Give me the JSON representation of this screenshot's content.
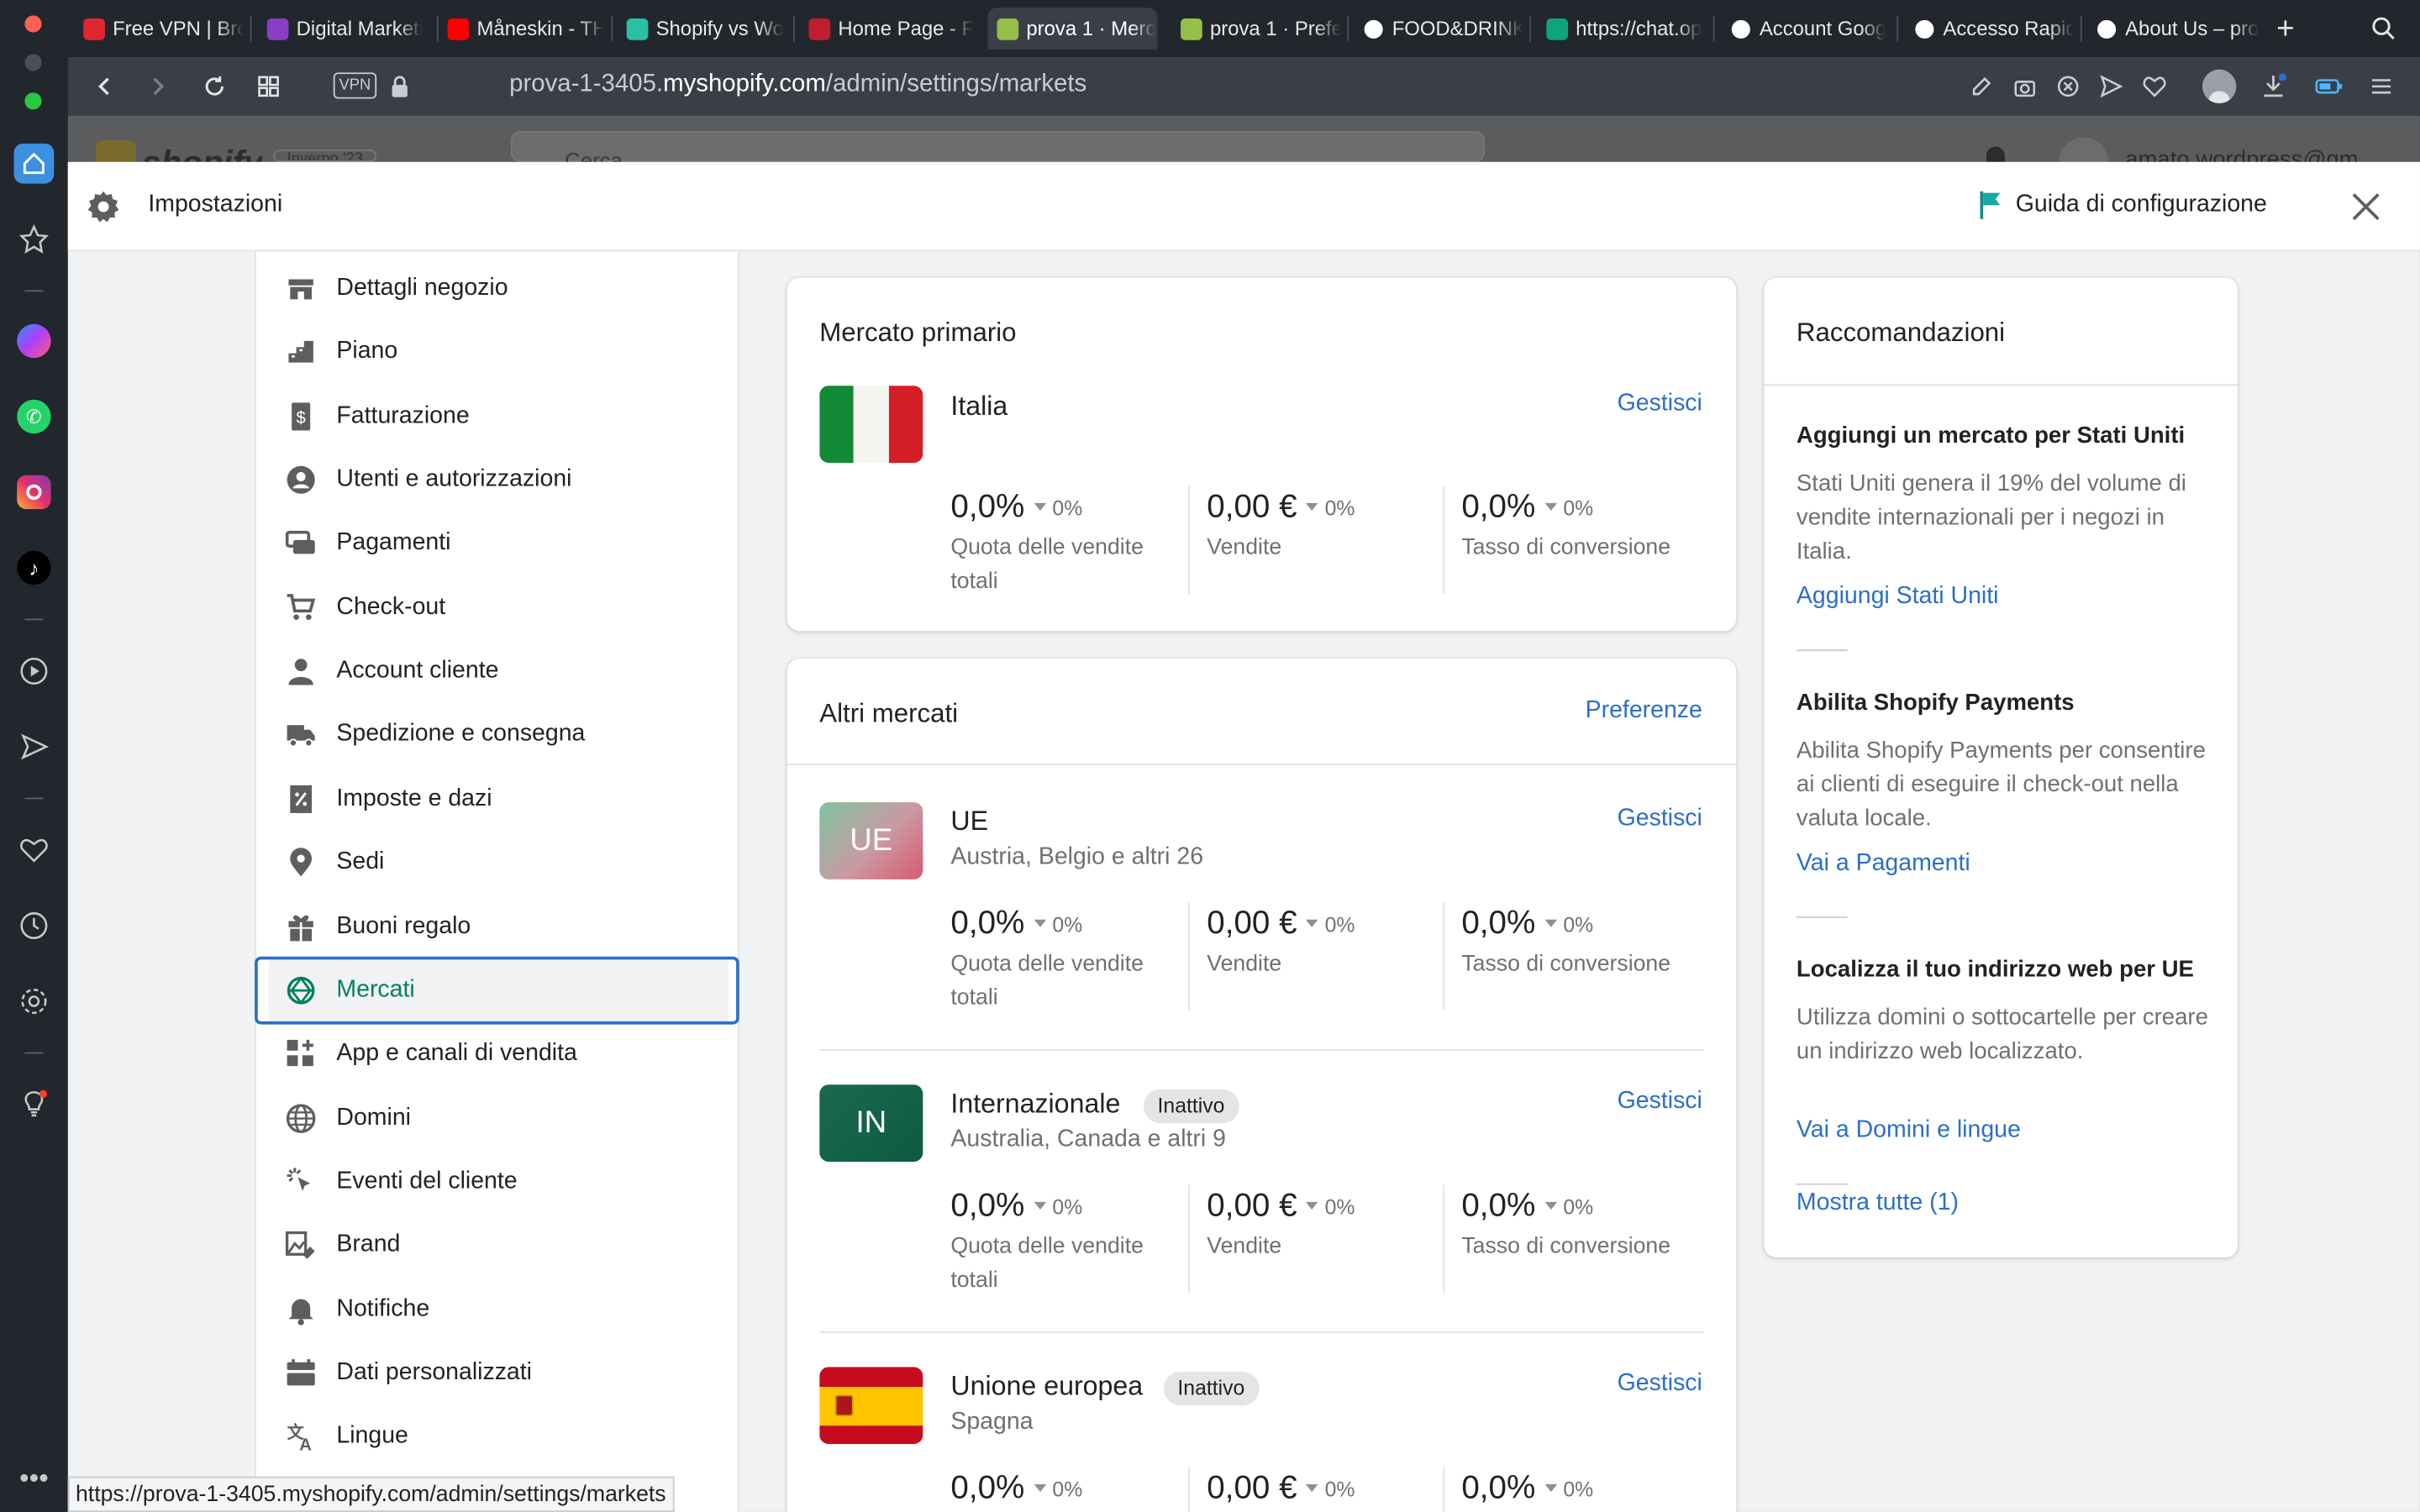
{
  "browser": {
    "tabs": [
      {
        "title": "Free VPN | Bro",
        "favicon": "opera-icon",
        "color": "#e0262f"
      },
      {
        "title": "Digital Marketi",
        "favicon": "digital-icon",
        "color": "#8b3dc6"
      },
      {
        "title": "Måneskin - TH",
        "favicon": "youtube-icon",
        "color": "#ff0000"
      },
      {
        "title": "Shopify vs Wo",
        "favicon": "bookmark-icon",
        "color": "#2bbfa4"
      },
      {
        "title": "Home Page - F",
        "favicon": "lips-icon",
        "color": "#c01e2e"
      },
      {
        "title": "prova 1 · Merc",
        "favicon": "shopify-icon",
        "color": "#95bf47"
      },
      {
        "title": "prova 1 · Prefe",
        "favicon": "shopify-icon",
        "color": "#95bf47"
      },
      {
        "title": "FOOD&DRINK",
        "favicon": "wix-icon",
        "color": "#ffffff"
      },
      {
        "title": "https://chat.op",
        "favicon": "openai-icon",
        "color": "#10a37f"
      },
      {
        "title": "Account Goog",
        "favicon": "google-icon",
        "color": "#ffffff"
      },
      {
        "title": "Accesso Rapid",
        "favicon": "grid-icon",
        "color": "#ffffff"
      },
      {
        "title": "About Us – pro",
        "favicon": "wix-icon",
        "color": "#ffffff"
      }
    ],
    "url_prefix": "prova-1-3405.",
    "url_domain": "myshopify.com",
    "url_path": "/admin/settings/markets",
    "vpn_label": "VPN",
    "status_url": "https://prova-1-3405.myshopify.com/admin/settings/markets"
  },
  "backdrop": {
    "store_name": "Inverno '23",
    "search_placeholder": "Cerca",
    "account": "amato.wordpress@gm"
  },
  "modal": {
    "title": "Impostazioni",
    "setup_guide": "Guida di configurazione"
  },
  "nav": [
    {
      "label": "Dettagli negozio",
      "icon": "store-icon"
    },
    {
      "label": "Piano",
      "icon": "plan-icon"
    },
    {
      "label": "Fatturazione",
      "icon": "billing-icon"
    },
    {
      "label": "Utenti e autorizzazioni",
      "icon": "user-circle-icon"
    },
    {
      "label": "Pagamenti",
      "icon": "payments-icon"
    },
    {
      "label": "Check-out",
      "icon": "cart-icon"
    },
    {
      "label": "Account cliente",
      "icon": "person-icon"
    },
    {
      "label": "Spedizione e consegna",
      "icon": "truck-icon"
    },
    {
      "label": "Imposte e dazi",
      "icon": "tax-icon"
    },
    {
      "label": "Sedi",
      "icon": "location-icon"
    },
    {
      "label": "Buoni regalo",
      "icon": "gift-icon"
    },
    {
      "label": "Mercati",
      "icon": "globe-markets-icon",
      "selected": true
    },
    {
      "label": "App e canali di vendita",
      "icon": "apps-icon"
    },
    {
      "label": "Domini",
      "icon": "globe-icon"
    },
    {
      "label": "Eventi del cliente",
      "icon": "cursor-icon"
    },
    {
      "label": "Brand",
      "icon": "brand-icon"
    },
    {
      "label": "Notifiche",
      "icon": "bell-icon"
    },
    {
      "label": "Dati personalizzati",
      "icon": "data-icon"
    },
    {
      "label": "Lingue",
      "icon": "language-icon"
    }
  ],
  "primary": {
    "heading": "Mercato primario",
    "name": "Italia",
    "manage": "Gestisci",
    "metrics": [
      {
        "value": "0,0%",
        "change": "0%",
        "label": "Quota delle vendite totali"
      },
      {
        "value": "0,00 €",
        "change": "0%",
        "label": "Vendite"
      },
      {
        "value": "0,0%",
        "change": "0%",
        "label": "Tasso di conversione"
      }
    ]
  },
  "others": {
    "heading": "Altri mercati",
    "preferences": "Preferenze",
    "markets": [
      {
        "code": "UE",
        "name": "UE",
        "subtitle": "Austria, Belgio e altri 26",
        "badge": "",
        "manage": "Gestisci",
        "metrics": [
          {
            "value": "0,0%",
            "change": "0%",
            "label": "Quota delle vendite totali"
          },
          {
            "value": "0,00 €",
            "change": "0%",
            "label": "Vendite"
          },
          {
            "value": "0,0%",
            "change": "0%",
            "label": "Tasso di conversione"
          }
        ]
      },
      {
        "code": "IN",
        "name": "Internazionale",
        "subtitle": "Australia, Canada e altri 9",
        "badge": "Inattivo",
        "manage": "Gestisci",
        "metrics": [
          {
            "value": "0,0%",
            "change": "0%",
            "label": "Quota delle vendite totali"
          },
          {
            "value": "0,00 €",
            "change": "0%",
            "label": "Vendite"
          },
          {
            "value": "0,0%",
            "change": "0%",
            "label": "Tasso di conversione"
          }
        ]
      },
      {
        "code": "",
        "name": "Unione europea",
        "subtitle": "Spagna",
        "badge": "Inattivo",
        "manage": "Gestisci",
        "metrics": [
          {
            "value": "0,0%",
            "change": "0%"
          },
          {
            "value": "0,00 €",
            "change": "0%"
          },
          {
            "value": "0,0%",
            "change": "0%"
          }
        ]
      }
    ]
  },
  "recommendations": {
    "heading": "Raccomandazioni",
    "items": [
      {
        "title": "Aggiungi un mercato per Stati Uniti",
        "body": "Stati Uniti genera il 19% del volume di vendite internazionali per i negozi in Italia.",
        "link": "Aggiungi Stati Uniti"
      },
      {
        "title": "Abilita Shopify Payments",
        "body": "Abilita Shopify Payments per consentire ai clienti di eseguire il check-out nella valuta locale.",
        "link": "Vai a Pagamenti"
      },
      {
        "title": "Localizza il tuo indirizzo web per UE",
        "body": "Utilizza domini o sottocartelle per creare un indirizzo web localizzato.",
        "link": "Vai a Domini e lingue"
      }
    ],
    "show_all": "Mostra tutte (1)"
  },
  "colors": {
    "accent_link": "#2c6ecb",
    "selected_green": "#008060",
    "focus_ring": "#2c6ecb"
  }
}
